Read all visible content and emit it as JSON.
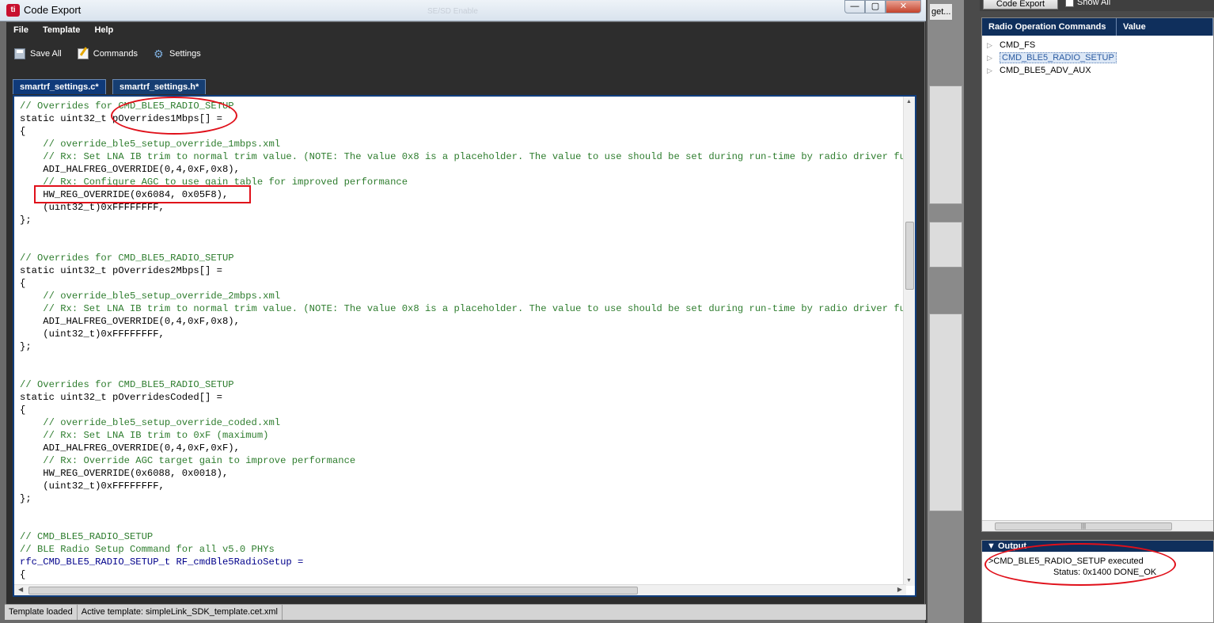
{
  "window": {
    "title": "Code Export",
    "ghost_title": "SE/SD Enable",
    "min_glyph": "—",
    "max_glyph": "▢",
    "close_glyph": "✕"
  },
  "menu": [
    "File",
    "Template",
    "Help"
  ],
  "toolbar": {
    "save_all": "Save All",
    "commands": "Commands",
    "settings": "Settings"
  },
  "tabs": [
    {
      "label": "smartrf_settings.c*",
      "active": true
    },
    {
      "label": "smartrf_settings.h*",
      "active": false
    }
  ],
  "code_lines": [
    {
      "t": "// Overrides for CMD_BLE5_RADIO_SETUP",
      "k": "cm"
    },
    {
      "t": "static uint32_t pOverrides1Mbps[] =",
      "k": ""
    },
    {
      "t": "{",
      "k": ""
    },
    {
      "t": "    // override_ble5_setup_override_1mbps.xml",
      "k": "cm"
    },
    {
      "t": "    // Rx: Set LNA IB trim to normal trim value. (NOTE: The value 0x8 is a placeholder. The value to use should be set during run-time by radio driver function",
      "k": "cm"
    },
    {
      "t": "    ADI_HALFREG_OVERRIDE(0,4,0xF,0x8),",
      "k": ""
    },
    {
      "t": "    // Rx: Configure AGC to use gain table for improved performance",
      "k": "cm"
    },
    {
      "t": "    HW_REG_OVERRIDE(0x6084, 0x05F8),",
      "k": ""
    },
    {
      "t": "    (uint32_t)0xFFFFFFFF,",
      "k": ""
    },
    {
      "t": "};",
      "k": ""
    },
    {
      "t": "",
      "k": ""
    },
    {
      "t": "",
      "k": ""
    },
    {
      "t": "// Overrides for CMD_BLE5_RADIO_SETUP",
      "k": "cm"
    },
    {
      "t": "static uint32_t pOverrides2Mbps[] =",
      "k": ""
    },
    {
      "t": "{",
      "k": ""
    },
    {
      "t": "    // override_ble5_setup_override_2mbps.xml",
      "k": "cm"
    },
    {
      "t": "    // Rx: Set LNA IB trim to normal trim value. (NOTE: The value 0x8 is a placeholder. The value to use should be set during run-time by radio driver function",
      "k": "cm"
    },
    {
      "t": "    ADI_HALFREG_OVERRIDE(0,4,0xF,0x8),",
      "k": ""
    },
    {
      "t": "    (uint32_t)0xFFFFFFFF,",
      "k": ""
    },
    {
      "t": "};",
      "k": ""
    },
    {
      "t": "",
      "k": ""
    },
    {
      "t": "",
      "k": ""
    },
    {
      "t": "// Overrides for CMD_BLE5_RADIO_SETUP",
      "k": "cm"
    },
    {
      "t": "static uint32_t pOverridesCoded[] =",
      "k": ""
    },
    {
      "t": "{",
      "k": ""
    },
    {
      "t": "    // override_ble5_setup_override_coded.xml",
      "k": "cm"
    },
    {
      "t": "    // Rx: Set LNA IB trim to 0xF (maximum)",
      "k": "cm"
    },
    {
      "t": "    ADI_HALFREG_OVERRIDE(0,4,0xF,0xF),",
      "k": ""
    },
    {
      "t": "    // Rx: Override AGC target gain to improve performance",
      "k": "cm"
    },
    {
      "t": "    HW_REG_OVERRIDE(0x6088, 0x0018),",
      "k": ""
    },
    {
      "t": "    (uint32_t)0xFFFFFFFF,",
      "k": ""
    },
    {
      "t": "};",
      "k": ""
    },
    {
      "t": "",
      "k": ""
    },
    {
      "t": "",
      "k": ""
    },
    {
      "t": "// CMD_BLE5_RADIO_SETUP",
      "k": "cm"
    },
    {
      "t": "// BLE Radio Setup Command for all v5.0 PHYs",
      "k": "cm"
    },
    {
      "t": "rfc_CMD_BLE5_RADIO_SETUP_t RF_cmdBle5RadioSetup =",
      "k": "ty"
    },
    {
      "t": "{",
      "k": ""
    }
  ],
  "status": {
    "left": "Template loaded",
    "right": "Active template: simpleLink_SDK_template.cet.xml"
  },
  "background_app": {
    "get_button": "get...",
    "code_export_button": "Code Export",
    "show_all": "Show All",
    "radio_panel": {
      "col1": "Radio Operation Commands",
      "col2": "Value",
      "items": [
        "CMD_FS",
        "CMD_BLE5_RADIO_SETUP",
        "CMD_BLE5_ADV_AUX"
      ]
    },
    "output": {
      "title": "Output",
      "line1": ">CMD_BLE5_RADIO_SETUP executed",
      "line2": "Status: 0x1400  DONE_OK"
    }
  },
  "colors": {
    "accent_navy": "#0f2f5c",
    "annotation_red": "#e0101a",
    "comment_green": "#2e7d2e"
  }
}
